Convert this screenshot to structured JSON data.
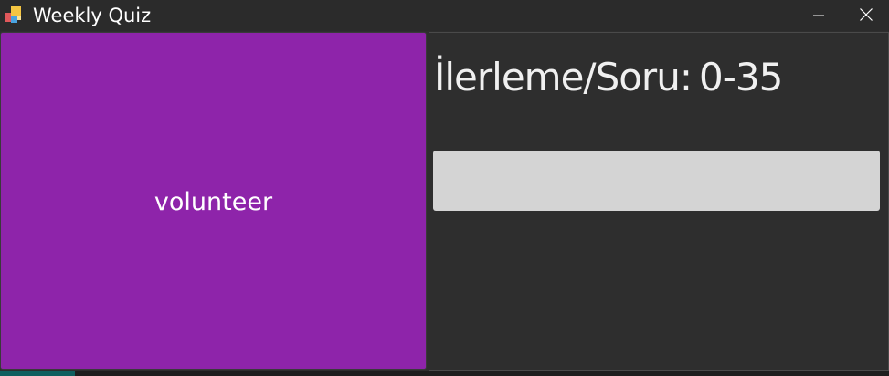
{
  "window": {
    "title": "Weekly Quiz",
    "minimize_icon": "minimize-icon",
    "close_icon": "close-icon",
    "app_icon": "app-icon"
  },
  "card": {
    "word": "volunteer",
    "background_color": "#8e24aa"
  },
  "progress": {
    "label": "İlerleme/Soru:",
    "value": "0-35"
  },
  "answer_input": {
    "value": "",
    "placeholder": ""
  }
}
